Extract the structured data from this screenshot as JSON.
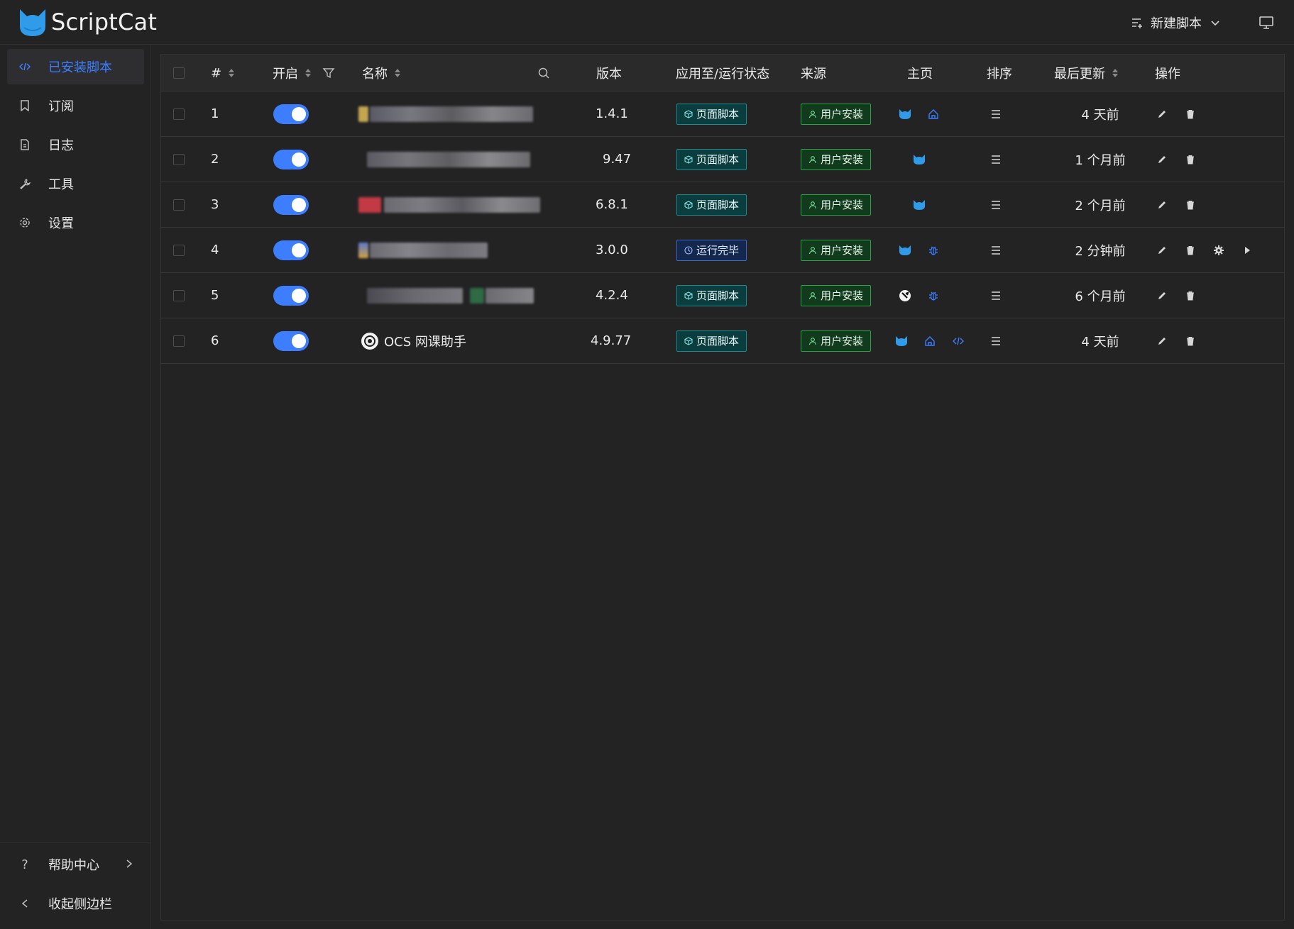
{
  "header": {
    "app_title": "ScriptCat",
    "new_script_label": "新建脚本"
  },
  "sidebar": {
    "items": [
      {
        "label": "已安装脚本",
        "icon": "code-icon",
        "active": true
      },
      {
        "label": "订阅",
        "icon": "bookmark-icon",
        "active": false
      },
      {
        "label": "日志",
        "icon": "log-icon",
        "active": false
      },
      {
        "label": "工具",
        "icon": "wrench-icon",
        "active": false
      },
      {
        "label": "设置",
        "icon": "gear-icon",
        "active": false
      }
    ],
    "help_label": "帮助中心",
    "collapse_label": "收起侧边栏"
  },
  "table": {
    "columns": {
      "index": "#",
      "enabled": "开启",
      "name": "名称",
      "version": "版本",
      "status": "应用至/运行状态",
      "source": "来源",
      "homepage": "主页",
      "sort": "排序",
      "updated": "最后更新",
      "actions": "操作"
    },
    "rows": [
      {
        "index": "1",
        "name": "",
        "version": "1.4.1",
        "status": "页面脚本",
        "status_kind": "page",
        "source": "用户安装",
        "homepage_icons": [
          "scriptcat-icon",
          "home-icon"
        ],
        "updated": "4 天前",
        "extra_actions": false
      },
      {
        "index": "2",
        "name": "",
        "version": "9.47",
        "status": "页面脚本",
        "status_kind": "page",
        "source": "用户安装",
        "homepage_icons": [
          "scriptcat-icon"
        ],
        "updated": "1 个月前",
        "extra_actions": false
      },
      {
        "index": "3",
        "name": "",
        "version": "6.8.1",
        "status": "页面脚本",
        "status_kind": "page",
        "source": "用户安装",
        "homepage_icons": [
          "scriptcat-icon"
        ],
        "updated": "2 个月前",
        "extra_actions": false
      },
      {
        "index": "4",
        "name": "",
        "version": "3.0.0",
        "status": "运行完毕",
        "status_kind": "background",
        "source": "用户安装",
        "homepage_icons": [
          "scriptcat-icon",
          "bug-icon"
        ],
        "updated": "2 分钟前",
        "extra_actions": true
      },
      {
        "index": "5",
        "name": "",
        "version": "4.2.4",
        "status": "页面脚本",
        "status_kind": "page",
        "source": "用户安装",
        "homepage_icons": [
          "author-icon",
          "bug-icon"
        ],
        "updated": "6 个月前",
        "extra_actions": false
      },
      {
        "index": "6",
        "name": "OCS 网课助手",
        "version": "4.9.77",
        "status": "页面脚本",
        "status_kind": "page",
        "source": "用户安装",
        "homepage_icons": [
          "scriptcat-icon",
          "home-icon",
          "code-icon"
        ],
        "updated": "4 天前",
        "extra_actions": false
      }
    ]
  },
  "colors": {
    "accent": "#3c7eff",
    "background": "#232324",
    "tag_page": "#1d8a8e",
    "tag_run": "#3a67c8",
    "tag_source": "#2ea24a"
  }
}
